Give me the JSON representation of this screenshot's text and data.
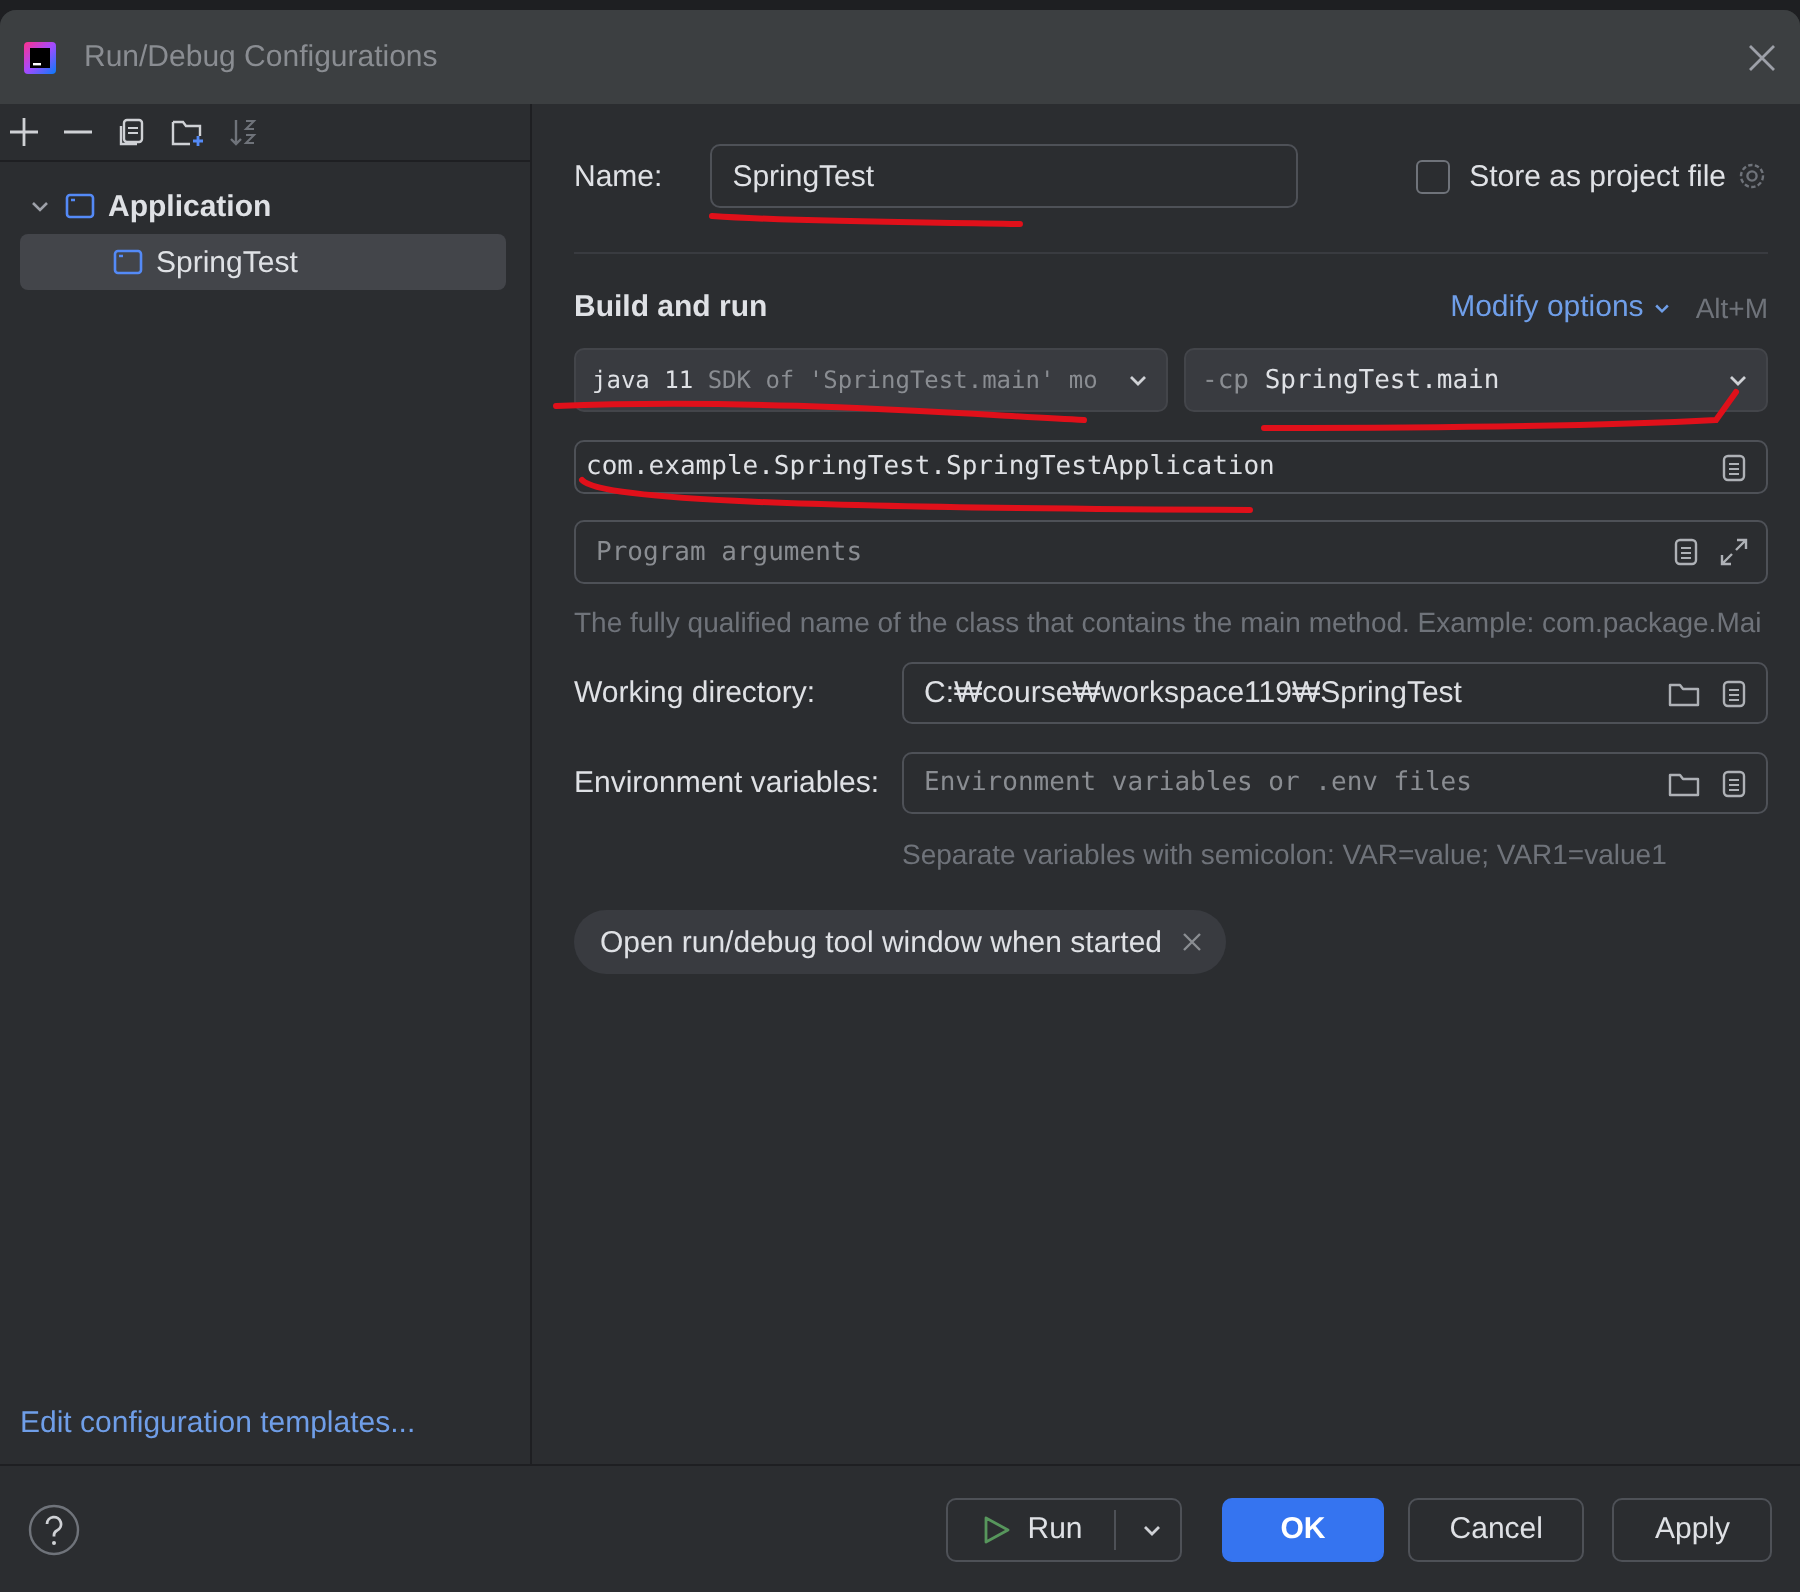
{
  "window": {
    "title": "Run/Debug Configurations"
  },
  "tree": [
    {
      "label": "Application",
      "expanded": true,
      "selected": false,
      "children": [
        {
          "label": "SpringTest",
          "selected": true
        }
      ]
    }
  ],
  "templates_link": "Edit configuration templates...",
  "name_field": {
    "label": "Name:",
    "value": "SpringTest"
  },
  "store_checkbox": {
    "label": "Store as project file",
    "checked": false
  },
  "section": {
    "title": "Build and run",
    "modify_options": "Modify options",
    "shortcut": "Alt+M"
  },
  "jdk_dropdown": {
    "value": "java 11",
    "hint": "SDK of 'SpringTest.main' mo"
  },
  "classpath_dropdown": {
    "prefix": "-cp",
    "value": "SpringTest.main"
  },
  "main_class_field": {
    "value": "com.example.SpringTest.SpringTestApplication"
  },
  "program_args_field": {
    "placeholder": "Program arguments"
  },
  "main_class_hint": "The fully qualified name of the class that contains the main method. Example: com.package.Mai",
  "working_directory": {
    "label": "Working directory:",
    "value": "C:₩course₩workspace119₩SpringTest"
  },
  "environment_variables": {
    "label": "Environment variables:",
    "placeholder": "Environment variables or .env files"
  },
  "env_hint": "Separate variables with semicolon: VAR=value; VAR1=value1",
  "option_tag": {
    "label": "Open run/debug tool window when started"
  },
  "buttons": [
    {
      "label": "Run",
      "kind": "split"
    },
    {
      "label": "OK",
      "kind": "primary"
    },
    {
      "label": "Cancel",
      "kind": "normal"
    },
    {
      "label": "Apply",
      "kind": "normal"
    }
  ]
}
